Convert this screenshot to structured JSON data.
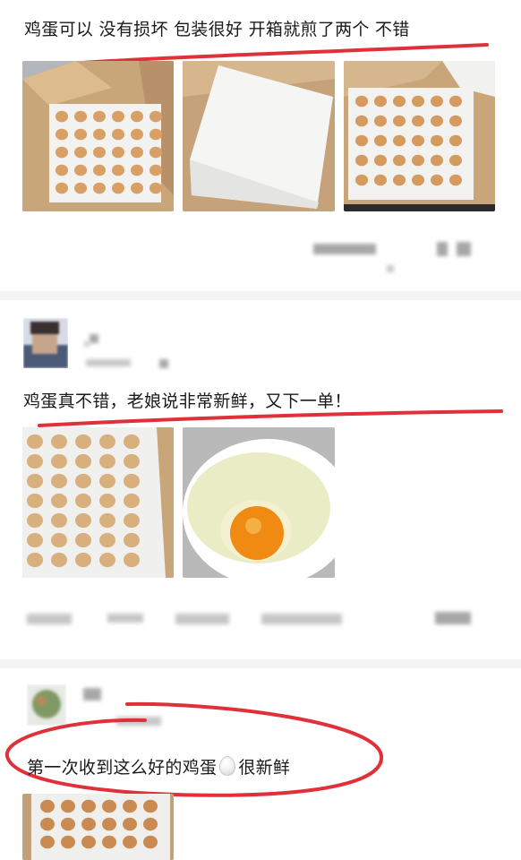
{
  "reviews": [
    {
      "text": "鸡蛋可以 没有损坏 包装很好 开箱就煎了两个 不错",
      "photos": [
        "egg-tray-in-box-photo",
        "foam-sheet-photo",
        "egg-tray-box-angle-photo"
      ]
    },
    {
      "text": "鸡蛋真不错，老娘说非常新鲜，又下一单！",
      "photos": [
        "egg-tray-closeup-photo",
        "cracked-egg-yolk-photo"
      ]
    },
    {
      "text_before": "第一次收到这么好的鸡蛋",
      "text_after": "很新鲜",
      "photos": [
        "egg-tray-partial-photo"
      ]
    }
  ],
  "colors": {
    "highlight_red": "#e0303a",
    "divider": "#f4f4f4",
    "cardboard": "#c9a57a",
    "egg_brown": "#d59a5e",
    "yolk": "#f08a12"
  },
  "icons": [
    "egg-emoji-icon"
  ]
}
